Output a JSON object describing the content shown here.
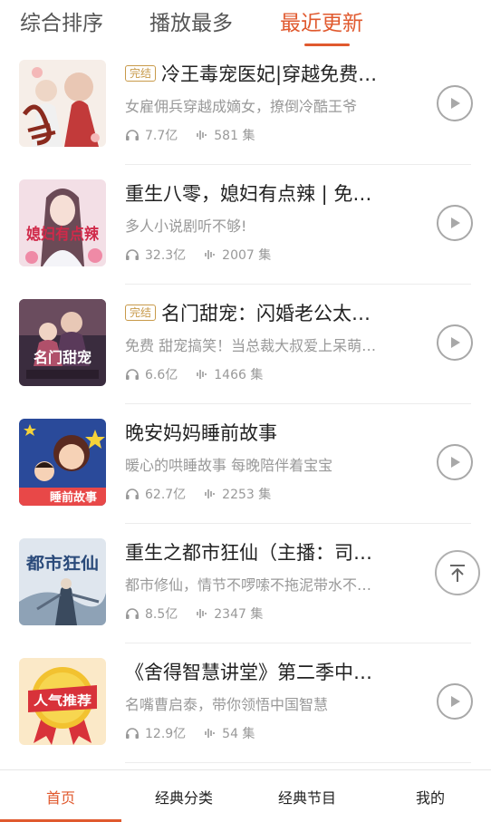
{
  "top_tabs": [
    {
      "label": "综合排序",
      "active": false
    },
    {
      "label": "播放最多",
      "active": false
    },
    {
      "label": "最近更新",
      "active": true
    }
  ],
  "colors": {
    "accent": "#e0592e",
    "badge": "#c89a4a",
    "muted": "#999999"
  },
  "items": [
    {
      "badge": "完结",
      "title": "冷王毒宠医妃|穿越免费…",
      "desc": "女雇佣兵穿越成嫡女，撩倒冷酷王爷",
      "plays": "7.7亿",
      "episodes": "581 集",
      "cover_text": ""
    },
    {
      "badge": "",
      "title": "重生八零，媳妇有点辣 | 免…",
      "desc": "多人小说剧听不够!",
      "plays": "32.3亿",
      "episodes": "2007 集",
      "cover_text": "媳妇有点辣"
    },
    {
      "badge": "完结",
      "title": "名门甜宠：闪婚老公太…",
      "desc": "免费 甜宠搞笑！当总裁大叔爱上呆萌…",
      "plays": "6.6亿",
      "episodes": "1466 集",
      "cover_text": "名门甜宠"
    },
    {
      "badge": "",
      "title": "晚安妈妈睡前故事",
      "desc": "暖心的哄睡故事 每晚陪伴着宝宝",
      "plays": "62.7亿",
      "episodes": "2253 集",
      "cover_text": "睡前故事"
    },
    {
      "badge": "",
      "title": "重生之都市狂仙（主播：司…",
      "desc": "都市修仙，情节不啰嗦不拖泥带水不…",
      "plays": "8.5亿",
      "episodes": "2347 集",
      "cover_text": "都市狂仙"
    },
    {
      "badge": "",
      "title": "《舍得智慧讲堂》第二季中…",
      "desc": "名嘴曹启泰，带你领悟中国智慧",
      "plays": "12.9亿",
      "episodes": "54 集",
      "cover_text": "人气推荐"
    }
  ],
  "bottom_nav": [
    {
      "label": "首页",
      "active": true
    },
    {
      "label": "经典分类",
      "active": false
    },
    {
      "label": "经典节目",
      "active": false
    },
    {
      "label": "我的",
      "active": false
    }
  ]
}
